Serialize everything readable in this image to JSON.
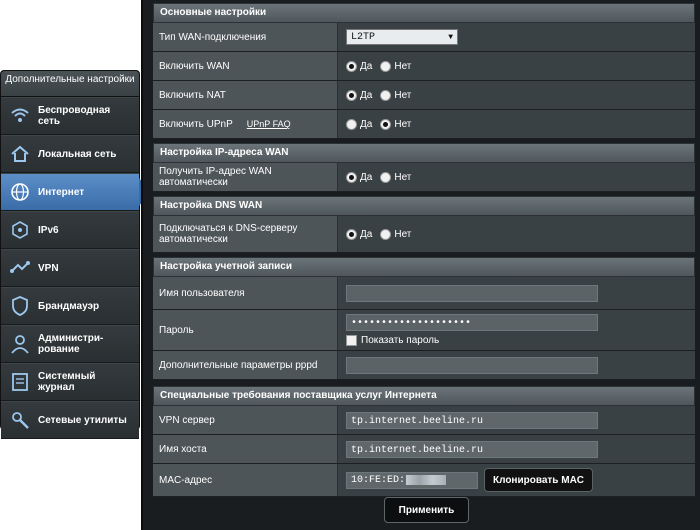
{
  "sidebar": {
    "title": "Дополнительные настройки",
    "items": [
      {
        "label": "Беспроводная сеть",
        "icon": "wifi-icon"
      },
      {
        "label": "Локальная сеть",
        "icon": "home-icon"
      },
      {
        "label": "Интернет",
        "icon": "globe-icon"
      },
      {
        "label": "IPv6",
        "icon": "ipv6-icon"
      },
      {
        "label": "VPN",
        "icon": "vpn-icon"
      },
      {
        "label": "Брандмауэр",
        "icon": "shield-icon"
      },
      {
        "label": "Администри-рование",
        "icon": "admin-user-icon"
      },
      {
        "label": "Системный журнал",
        "icon": "log-icon"
      },
      {
        "label": "Сетевые утилиты",
        "icon": "tools-icon"
      }
    ],
    "active_index": 2
  },
  "basic": {
    "title": "Основные настройки",
    "wan_type_label": "Тип WAN-подключения",
    "wan_type_value": "L2TP",
    "enable_wan_label": "Включить WAN",
    "enable_nat_label": "Включить NAT",
    "enable_upnp_label": "Включить UPnP",
    "upnp_faq": "UPnP FAQ"
  },
  "radio": {
    "yes": "Да",
    "no": "Нет"
  },
  "wan_ip": {
    "title": "Настройка IP-адреса WAN",
    "auto_label": "Получить IP-адрес WAN автоматически"
  },
  "dns": {
    "title": "Настройка DNS WAN",
    "auto_label": "Подключаться к DNS-серверу автоматически"
  },
  "account": {
    "title": "Настройка учетной записи",
    "username_label": "Имя пользователя",
    "username_value": "",
    "password_label": "Пароль",
    "password_value": "••••••••••••••••••••",
    "show_password": "Показать пароль",
    "pppd_label": "Дополнительные параметры pppd",
    "pppd_value": ""
  },
  "isp": {
    "title": "Специальные требования поставщика услуг Интернета",
    "vpn_label": "VPN сервер",
    "vpn_value": "tp.internet.beeline.ru",
    "host_label": "Имя хоста",
    "host_value": "tp.internet.beeline.ru",
    "mac_label": "MAC-адрес",
    "mac_value": "10:FE:ED:",
    "clone_button": "Клонировать MAC"
  },
  "apply_button": "Применить"
}
